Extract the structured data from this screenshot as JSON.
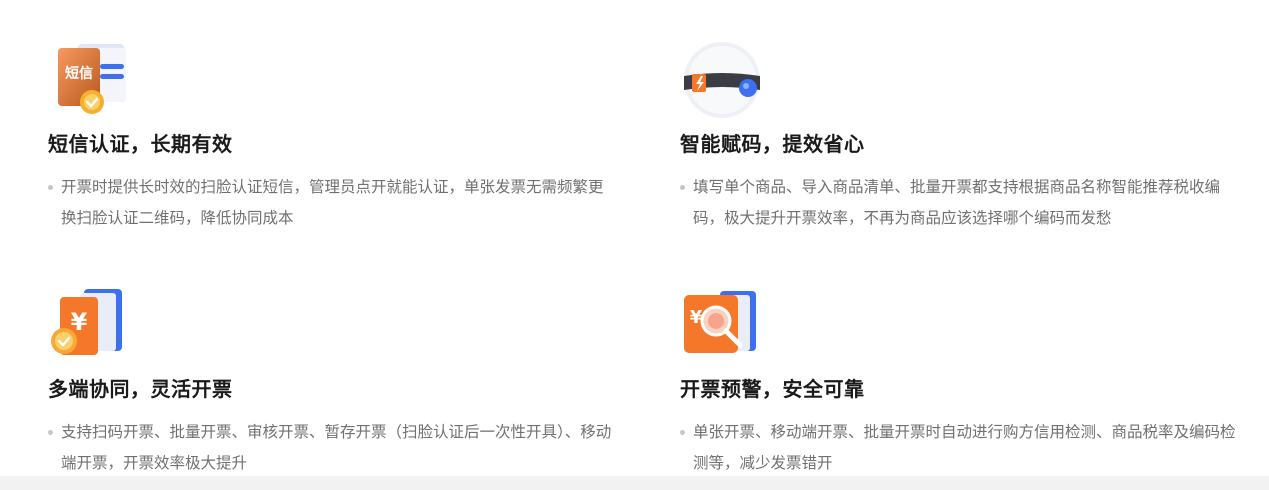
{
  "features": [
    {
      "icon": "sms-verify-icon",
      "icon_text": "短信",
      "title": "短信认证，长期有效",
      "desc": "开票时提供长时效的扫脸认证短信，管理员点开就能认证，单张发票无需频繁更换扫脸认证二维码，降低协同成本"
    },
    {
      "icon": "smart-code-icon",
      "title": "智能赋码，提效省心",
      "desc": "填写单个商品、导入商品清单、批量开票都支持根据商品名称智能推荐税收编码，极大提升开票效率，不再为商品应该选择哪个编码而发愁"
    },
    {
      "icon": "yuan-document-icon",
      "icon_text": "¥",
      "title": "多端协同，灵活开票",
      "desc": "支持扫码开票、批量开票、审核开票、暂存开票（扫脸认证后一次性开具）、移动端开票，开票效率极大提升"
    },
    {
      "icon": "invoice-alert-icon",
      "icon_text": "¥",
      "title": "开票预警，安全可靠",
      "desc": "单张开票、移动端开票、批量开票时自动进行购方信用检测、商品税率及编码检测等，减少发票错开"
    }
  ],
  "colors": {
    "orange": "#f5772a",
    "blue": "#3d6ff0",
    "title": "#1a1a1a",
    "desc": "#707070"
  }
}
